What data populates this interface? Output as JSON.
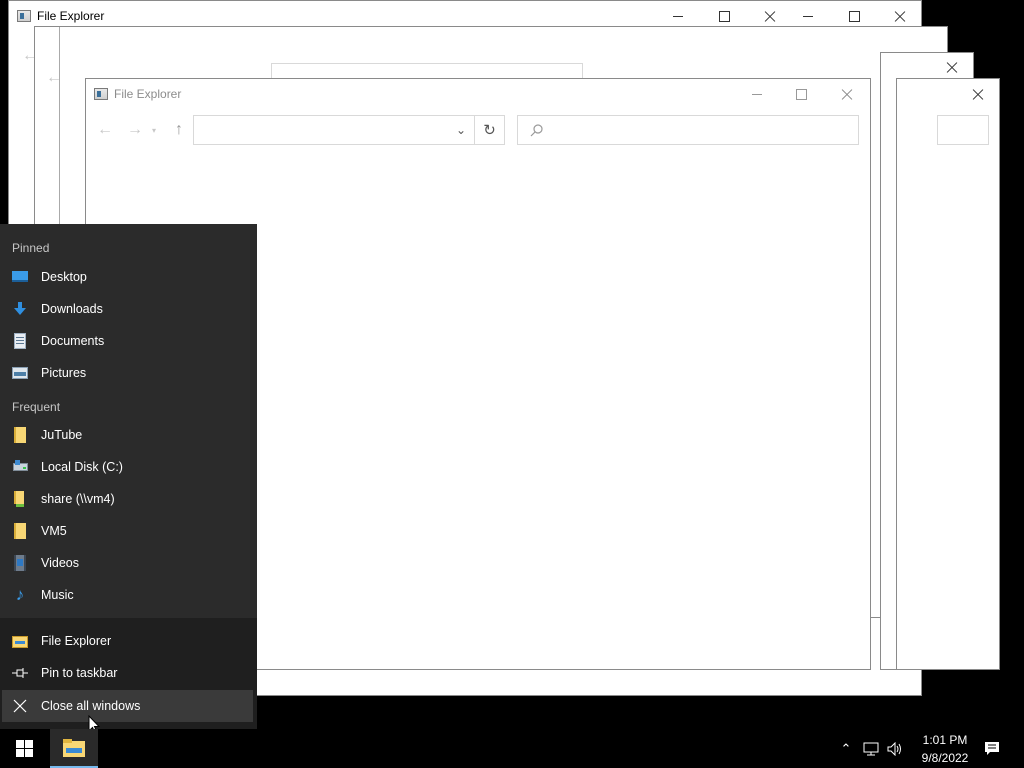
{
  "windows": {
    "back_title": "File Explorer",
    "front_title": "File Explorer"
  },
  "jumplist": {
    "pinned_header": "Pinned",
    "pinned": [
      {
        "label": "Desktop",
        "icon": "desktop-icon"
      },
      {
        "label": "Downloads",
        "icon": "download-arrow-icon"
      },
      {
        "label": "Documents",
        "icon": "document-icon"
      },
      {
        "label": "Pictures",
        "icon": "pictures-icon"
      }
    ],
    "frequent_header": "Frequent",
    "frequent": [
      {
        "label": "JuTube",
        "icon": "folder-icon"
      },
      {
        "label": "Local Disk (C:)",
        "icon": "drive-icon"
      },
      {
        "label": "share (\\\\vm4)",
        "icon": "network-folder-icon"
      },
      {
        "label": "VM5",
        "icon": "folder-icon"
      },
      {
        "label": "Videos",
        "icon": "videos-icon"
      },
      {
        "label": "Music",
        "icon": "music-note-icon"
      }
    ],
    "tasks": [
      {
        "label": "File Explorer",
        "icon": "file-explorer-icon"
      },
      {
        "label": "Pin to taskbar",
        "icon": "pin-icon"
      },
      {
        "label": "Close all windows",
        "icon": "close-icon"
      }
    ]
  },
  "taskbar": {
    "time": "1:01 PM",
    "date": "9/8/2022"
  },
  "colors": {
    "jumplist_bg": "#2b2b2b",
    "tasks_bg": "#1f1f1f",
    "accent": "#76b9ed",
    "folder": "#f8d775"
  }
}
